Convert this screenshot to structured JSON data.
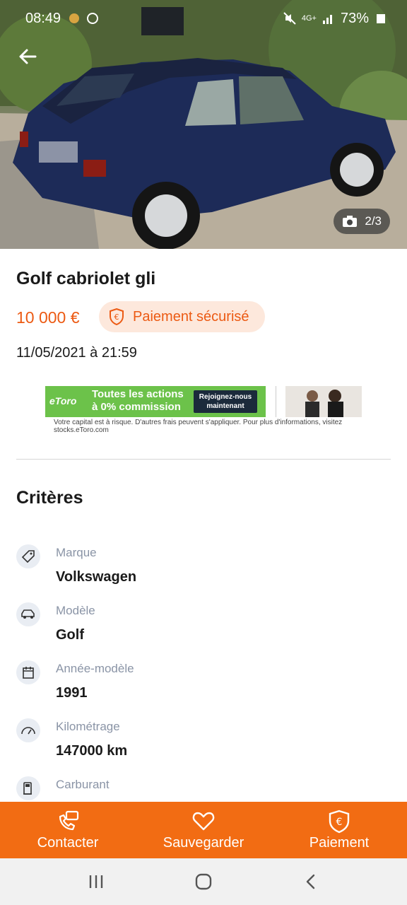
{
  "status_bar": {
    "time": "08:49",
    "battery": "73%",
    "network": "4G+"
  },
  "photo": {
    "counter": "2/3"
  },
  "listing": {
    "title": "Golf cabriolet gli",
    "price": "10 000 €",
    "secure_payment": "Paiement sécurisé",
    "date": "11/05/2021 à 21:59"
  },
  "ad": {
    "logo": "eToro",
    "headline_line1": "Toutes les actions",
    "headline_line2": "à 0% commission",
    "cta_line1": "Rejoignez-nous",
    "cta_line2": "maintenant",
    "disclaimer": "Votre capital est à risque. D'autres frais peuvent s'appliquer. Pour plus d'informations, visitez stocks.eToro.com"
  },
  "criteria": {
    "title": "Critères",
    "items": [
      {
        "label": "Marque",
        "value": "Volkswagen",
        "icon": "tag-icon"
      },
      {
        "label": "Modèle",
        "value": "Golf",
        "icon": "car-icon"
      },
      {
        "label": "Année-modèle",
        "value": "1991",
        "icon": "calendar-icon"
      },
      {
        "label": "Kilométrage",
        "value": "147000 km",
        "icon": "speedometer-icon"
      },
      {
        "label": "Carburant",
        "value": "",
        "icon": "fuel-pump-icon"
      }
    ]
  },
  "actions": {
    "contact": "Contacter",
    "save": "Sauvegarder",
    "payment": "Paiement"
  },
  "colors": {
    "accent": "#f26c13",
    "price": "#ec5a13",
    "badge_bg": "#fde8dc"
  }
}
